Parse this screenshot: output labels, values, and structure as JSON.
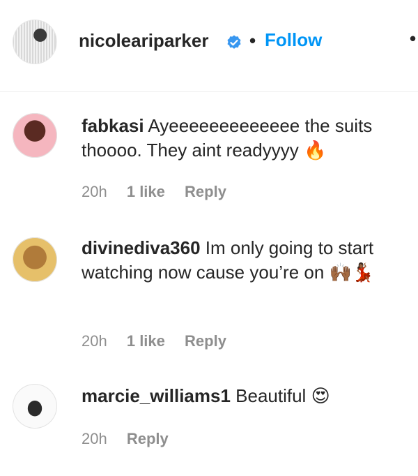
{
  "header": {
    "username": "nicoleariparker",
    "separator": "•",
    "follow_label": "Follow",
    "more_label": "•",
    "verified_icon": "verified-badge-icon",
    "accent_color": "#0095f6"
  },
  "comments": [
    {
      "user": "fabkasi",
      "text": "Ayeeeeeeeeeeeee the suits thoooo. They aint readyyyy",
      "emoji": "🔥",
      "time": "20h",
      "likes": "1 like",
      "reply": "Reply"
    },
    {
      "user": "divinediva360",
      "text": "Im only going to start watching now cause you’re on",
      "emoji": "🙌🏾💃🏾",
      "time": "20h",
      "likes": "1 like",
      "reply": "Reply"
    },
    {
      "user": "marcie_williams1",
      "text": "Beautiful",
      "emoji": "😍",
      "time": "20h",
      "reply": "Reply"
    }
  ]
}
